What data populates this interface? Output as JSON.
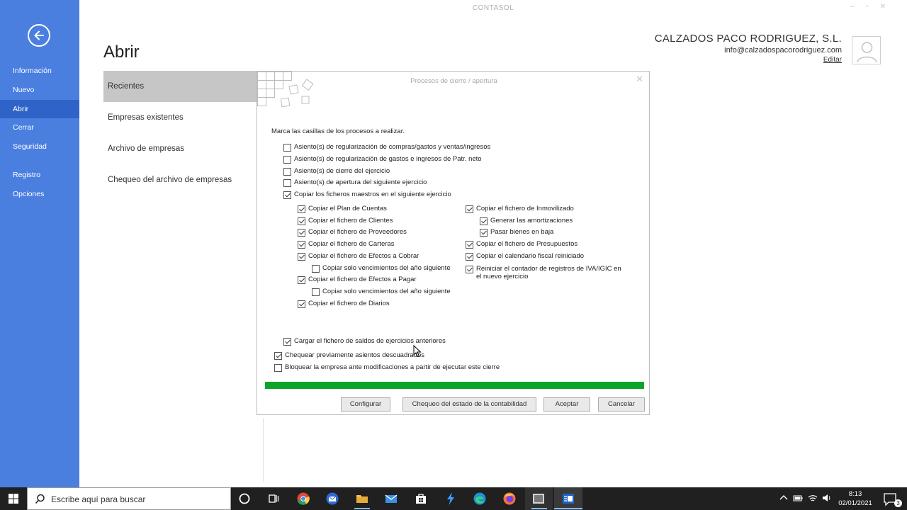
{
  "app": {
    "title": "CONTASOL"
  },
  "sidebar": {
    "items": [
      {
        "label": "Información",
        "active": false
      },
      {
        "label": "Nuevo",
        "active": false
      },
      {
        "label": "Abrir",
        "active": true
      },
      {
        "label": "Cerrar",
        "active": false
      },
      {
        "label": "Seguridad",
        "active": false
      },
      {
        "label": "Registro",
        "active": false
      },
      {
        "label": "Opciones",
        "active": false
      }
    ]
  },
  "page": {
    "title": "Abrir"
  },
  "company": {
    "name": "CALZADOS PACO RODRIGUEZ, S.L.",
    "email": "info@calzadospacorodriguez.com",
    "edit_label": "Editar"
  },
  "open_menu": {
    "items": [
      {
        "label": "Recientes",
        "active": true
      },
      {
        "label": "Empresas existentes",
        "active": false
      },
      {
        "label": "Archivo de empresas",
        "active": false
      },
      {
        "label": "Chequeo del archivo de empresas",
        "active": false
      }
    ]
  },
  "dialog": {
    "title": "Procesos de cierre / apertura",
    "instruction": "Marca las casillas de los procesos a realizar.",
    "options": {
      "reg_compras": {
        "label": "Asiento(s) de regularización de compras/gastos y ventas/ingresos",
        "checked": false
      },
      "reg_patr": {
        "label": "Asiento(s) de regularización de gastos e ingresos de Patr. neto",
        "checked": false
      },
      "cierre": {
        "label": "Asiento(s) de cierre del ejercicio",
        "checked": false
      },
      "apertura": {
        "label": "Asiento(s) de apertura del siguiente ejercicio",
        "checked": false
      },
      "copiar_maestros": {
        "label": "Copiar los ficheros maestros en el siguiente ejercicio",
        "checked": true
      },
      "plan_cuentas": {
        "label": "Copiar el Plan de Cuentas",
        "checked": true
      },
      "clientes": {
        "label": "Copiar el fichero de Clientes",
        "checked": true
      },
      "proveedores": {
        "label": "Copiar el fichero de Proveedores",
        "checked": true
      },
      "carteras": {
        "label": "Copiar el fichero de Carteras",
        "checked": true
      },
      "efectos_cobrar": {
        "label": "Copiar el fichero de Efectos a Cobrar",
        "checked": true
      },
      "venc_cobrar": {
        "label": "Copiar solo vencimientos del año siguiente",
        "checked": false
      },
      "efectos_pagar": {
        "label": "Copiar el fichero de Efectos a Pagar",
        "checked": true
      },
      "venc_pagar": {
        "label": "Copiar solo vencimientos del año siguiente",
        "checked": false
      },
      "diarios": {
        "label": "Copiar el fichero de Diarios",
        "checked": true
      },
      "inmovilizado": {
        "label": "Copiar el fichero de Inmovilizado",
        "checked": true
      },
      "amortizaciones": {
        "label": "Generar las amortizaciones",
        "checked": true
      },
      "bienes_baja": {
        "label": "Pasar bienes en baja",
        "checked": true
      },
      "presupuestos": {
        "label": "Copiar el fichero de Presupuestos",
        "checked": true
      },
      "calendario": {
        "label": "Copiar el calendario fiscal reiniciado",
        "checked": true
      },
      "contador_iva": {
        "label": "Reiniciar el contador de registros de IVA/IGIC en el nuevo ejercicio",
        "checked": true
      },
      "saldos": {
        "label": "Cargar el fichero de saldos de ejercicios anteriores",
        "checked": true
      },
      "chequear": {
        "label": "Chequear previamente asientos descuadrados",
        "checked": true
      },
      "bloquear": {
        "label": "Bloquear la empresa ante modificaciones a partir de ejecutar este cierre",
        "checked": false
      }
    },
    "progress": 1.0,
    "progress_color": "#0ca52a",
    "buttons": {
      "configurar": "Configurar",
      "chequeo": "Chequeo del estado de la contabilidad",
      "aceptar": "Aceptar",
      "cancelar": "Cancelar"
    }
  },
  "taskbar": {
    "search_placeholder": "Escribe aquí para buscar",
    "icons": [
      "cortana-icon",
      "task-view-icon",
      "chrome-icon",
      "thunderbird-icon",
      "file-explorer-icon",
      "mail-icon",
      "store-icon",
      "app-bolt-icon",
      "edge-icon",
      "firefox-icon",
      "screen-capture-icon",
      "contasol-icon"
    ],
    "time": "8:13",
    "date": "02/01/2021",
    "notification_count": "3"
  },
  "colors": {
    "sidebar": "#4a7fe0",
    "sidebar_active": "#2f63c8",
    "accent_progress": "#0ca52a"
  }
}
